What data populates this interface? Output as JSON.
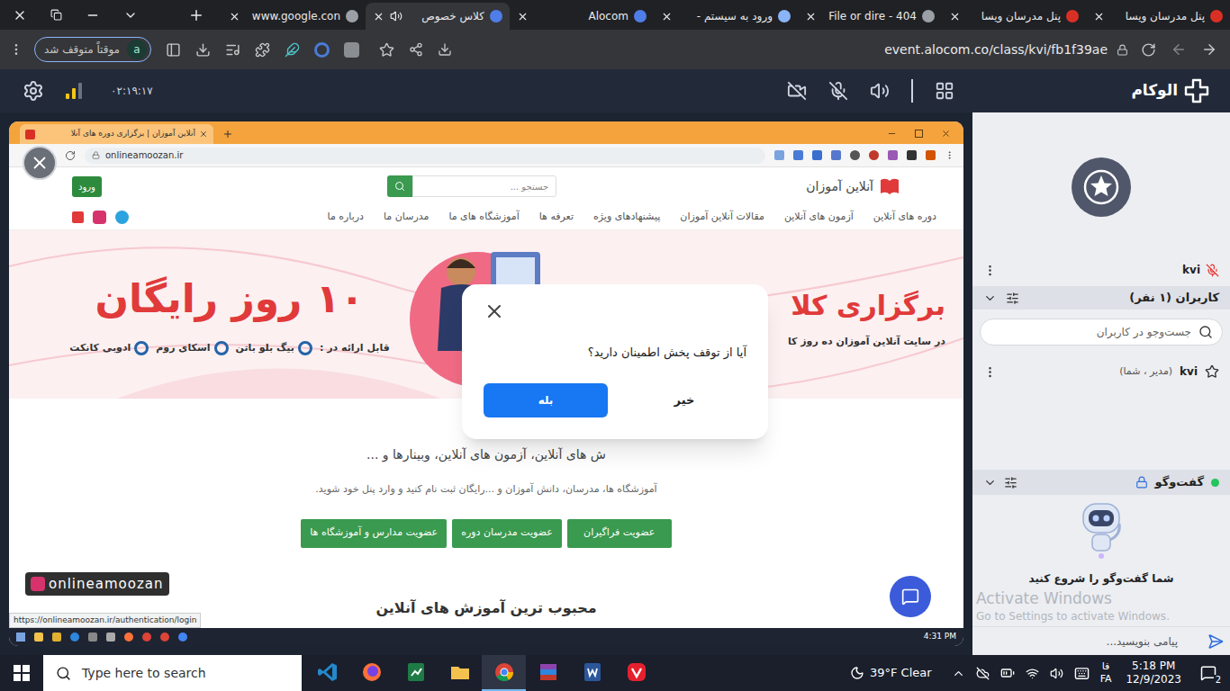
{
  "browser": {
    "tabs": [
      {
        "title": "پنل مدرسان ویسا",
        "selected": false,
        "audible": false,
        "color": "#d93025"
      },
      {
        "title": "پنل مدرسان ویسا",
        "selected": false,
        "audible": false,
        "color": "#d93025"
      },
      {
        "title": "404 - File or dire",
        "selected": false,
        "audible": false,
        "color": "#9aa0a6"
      },
      {
        "title": "ورود به سیستم -",
        "selected": false,
        "audible": false,
        "color": "#8ab4f8"
      },
      {
        "title": "Alocom",
        "selected": false,
        "audible": false,
        "color": "#4f7ee8"
      },
      {
        "title": "کلاس خصوص",
        "selected": true,
        "audible": true,
        "color": "#4f7ee8"
      },
      {
        "title": "www.google.con",
        "selected": false,
        "audible": false,
        "color": "#9aa0a6"
      }
    ],
    "profile": {
      "initial": "a",
      "status": "موقتاً متوقف شد"
    },
    "url": "event.alocom.co/class/kvi/fb1f39ae"
  },
  "app_header": {
    "brand": "الوکام",
    "timer": "۰۲:۱۹:۱۷",
    "signal_level": 0.67,
    "camera_on": false,
    "mic_on": false
  },
  "shared_screen": {
    "tab_title": "آنلاین آموزان | برگزاری دوره های آنلا",
    "url": "onlineamoozan.ir",
    "site": {
      "logo": "آنلاین آموزان",
      "search_placeholder": "جستجو ...",
      "login": "ورود",
      "nav": [
        "دوره های آنلاین",
        "آزمون های آنلاین",
        "مقالات آنلاین آموزان",
        "پیشنهادهای ویژه",
        "تعرفه ها",
        "آموزشگاه های ما",
        "مدرسان ما",
        "درباره ما"
      ],
      "hero": {
        "offer": "۱۰ روز رایگان",
        "headline": "برگزاری کلا",
        "subtitle": "در سایت آنلاین آموزان ده روز کا",
        "platforms_label": "قابل ارائه در :",
        "platforms": [
          "بیگ بلو باتن",
          "اسکای روم",
          "ادوبی کانکت"
        ]
      },
      "tagline": "ش های آنلاین، آزمون های آنلاین، وبینارها و ...",
      "description": "آموزشگاه ها، مدرسان، دانش آموزان و ...رایگان ثبت نام کنید و وارد پنل خود شوید.",
      "signup_buttons": [
        "عضویت فراگیران",
        "عضویت مدرسان دوره",
        "عضویت مدارس و آموزشگاه ها"
      ],
      "popular_heading": "محبوب ترین آموزش های آنلاین"
    },
    "status_link": "https://onlineamoozan.ir/authentication/login",
    "watermark": "onlineamoozan",
    "clock": "4:31 PM"
  },
  "dialog": {
    "message": "آیا از توقف پخش اطمینان دارید؟",
    "cancel": "خیر",
    "confirm": "بله"
  },
  "sidebar": {
    "participant": {
      "name": "kvi",
      "muted": true
    },
    "users": {
      "title": "کاربران (۱ نفر)",
      "search_placeholder": "جست‌وجو در کاربران",
      "items": [
        {
          "name": "kvi",
          "role": "(مدیر ، شما)"
        }
      ]
    },
    "chat": {
      "title": "گفت‌وگو",
      "online": true,
      "locked": true,
      "empty_text": "شما گفت‌وگو را شروع کنید",
      "input_placeholder": "پیامی بنویسید..."
    }
  },
  "activation_watermark": {
    "title": "Activate Windows",
    "subtitle": "Go to Settings to activate Windows."
  },
  "taskbar": {
    "search_placeholder": "Type here to search",
    "apps": [
      {
        "kind": "vscode",
        "selected": false
      },
      {
        "kind": "firefox",
        "selected": false
      },
      {
        "kind": "sheet",
        "selected": false
      },
      {
        "kind": "explorer",
        "selected": false
      },
      {
        "kind": "chrome",
        "selected": true
      },
      {
        "kind": "winrar",
        "selected": false
      },
      {
        "kind": "word",
        "selected": false
      },
      {
        "kind": "vivaldi",
        "selected": false
      }
    ],
    "weather": "39°F Clear",
    "language": {
      "script": "فا",
      "code": "FA"
    },
    "time": "5:18 PM",
    "date": "12/9/2023",
    "notifications": "2"
  }
}
